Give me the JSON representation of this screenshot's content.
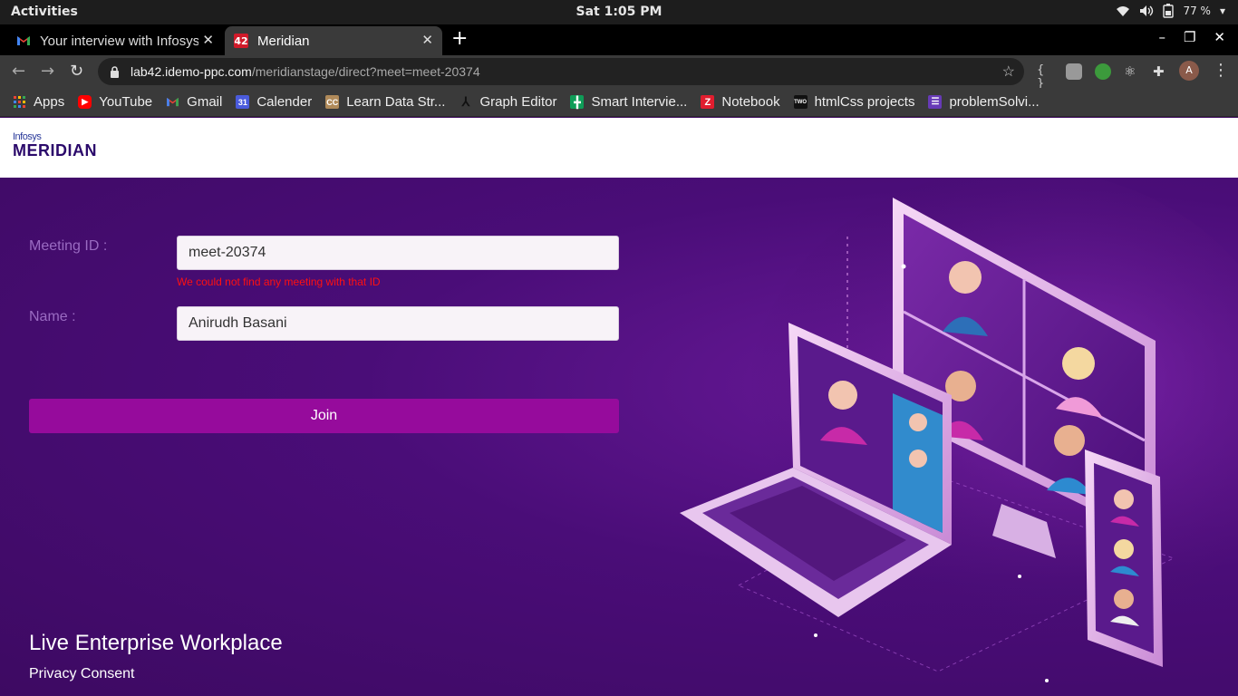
{
  "system": {
    "activities": "Activities",
    "clock": "Sat  1:05 PM",
    "battery": "77 %"
  },
  "tabs": [
    {
      "title": "Your interview with Infosys",
      "icon": "gmail-icon"
    },
    {
      "title": "Meridian",
      "icon": "42-icon"
    }
  ],
  "address": {
    "host": "lab42.idemo-ppc.com",
    "path": "/meridianstage/direct?meet=meet-20374"
  },
  "profile": {
    "initial": "A"
  },
  "bookmarks": [
    {
      "label": "Apps",
      "icon": "apps-grid-icon",
      "color": "#e53935"
    },
    {
      "label": "YouTube",
      "icon": "youtube-icon",
      "color": "#ff0000"
    },
    {
      "label": "Gmail",
      "icon": "gmail-icon",
      "color": "#ea4335"
    },
    {
      "label": "Calender",
      "icon": "calendar-icon",
      "color": "#4a5bdc"
    },
    {
      "label": "Learn Data Str...",
      "icon": "cc-icon",
      "color": "#b08a5a"
    },
    {
      "label": "Graph Editor",
      "icon": "graph-icon",
      "color": "#333333"
    },
    {
      "label": "Smart Intervie...",
      "icon": "plus-doc-icon",
      "color": "#0f9d58"
    },
    {
      "label": "Notebook",
      "icon": "z-icon",
      "color": "#e11d2e"
    },
    {
      "label": "htmlCss projects",
      "icon": "two-icon",
      "color": "#111111"
    },
    {
      "label": "problemSolvi...",
      "icon": "forms-icon",
      "color": "#673ab7"
    }
  ],
  "logo": {
    "line1": "Infosys",
    "line2": "MERIDIAN"
  },
  "form": {
    "meeting_label": "Meeting ID :",
    "meeting_value": "meet-20374",
    "error": "We could not find any meeting with that ID",
    "name_label": "Name :",
    "name_value": "Anirudh Basani",
    "join": "Join"
  },
  "footer": {
    "tagline": "Live Enterprise Workplace",
    "privacy": "Privacy Consent"
  },
  "colors": {
    "accent": "#960b9c",
    "background": "#4a0d78",
    "error": "#ff1010"
  }
}
